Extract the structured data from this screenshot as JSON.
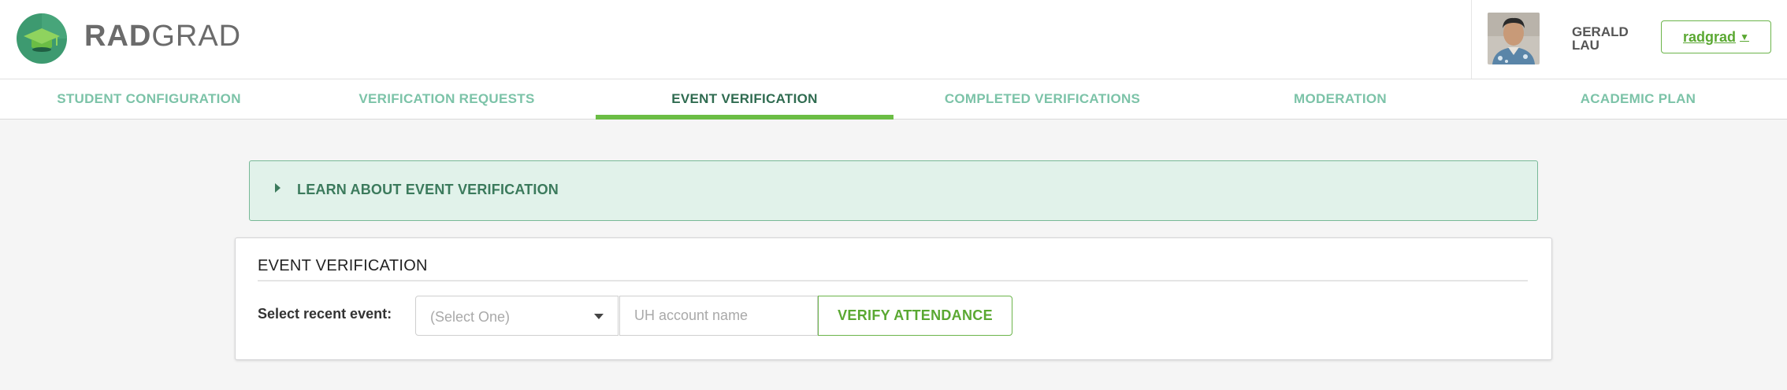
{
  "header": {
    "brand_bold": "RAD",
    "brand_light": "GRAD",
    "user_name": "GERALD LAU",
    "user_menu_label": "radgrad",
    "colors": {
      "logo_green": "#3d9a70",
      "accent": "#6bbd45"
    }
  },
  "tabs": [
    {
      "label": "STUDENT CONFIGURATION",
      "active": false
    },
    {
      "label": "VERIFICATION REQUESTS",
      "active": false
    },
    {
      "label": "EVENT VERIFICATION",
      "active": true
    },
    {
      "label": "COMPLETED VERIFICATIONS",
      "active": false
    },
    {
      "label": "MODERATION",
      "active": false
    },
    {
      "label": "ACADEMIC PLAN",
      "active": false
    }
  ],
  "learn_panel": {
    "title": "LEARN ABOUT EVENT VERIFICATION"
  },
  "event_card": {
    "title": "EVENT VERIFICATION",
    "select_label": "Select recent event:",
    "select_value": "(Select One)",
    "account_placeholder": "UH account name",
    "verify_button": "VERIFY ATTENDANCE"
  }
}
